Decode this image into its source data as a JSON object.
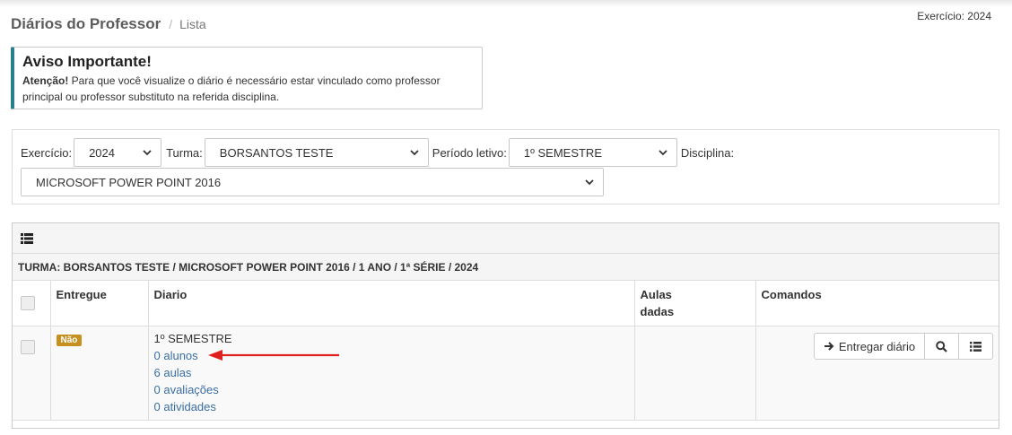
{
  "header": {
    "title": "Diários do Professor",
    "separator": "/",
    "crumb": "Lista",
    "exercicio": "Exercício: 2024"
  },
  "alert": {
    "title": "Aviso Importante!",
    "strong": "Atenção!",
    "line1": " Para que você visualize o diário é necessário estar vinculado como professor",
    "line2": "principal ou professor substituto na referida disciplina."
  },
  "filters": {
    "exercicio_label": "Exercício:",
    "exercicio_value": "2024",
    "turma_label": "Turma:",
    "turma_value": "BORSANTOS TESTE",
    "periodo_label": "Período letivo:",
    "periodo_value": "1º SEMESTRE",
    "disciplina_label": "Disciplina:",
    "disciplina_value": "MICROSOFT POWER POINT 2016"
  },
  "panel": {
    "turma_line": "TURMA: BORSANTOS TESTE / MICROSOFT POWER POINT 2016 / 1 ANO / 1ª SÉRIE / 2024",
    "columns": {
      "entregue": "Entregue",
      "diario": "Diario",
      "aulas_line1": "Aulas",
      "aulas_line2": "dadas",
      "comandos": "Comandos"
    },
    "row": {
      "badge": "Não",
      "periodo": "1º SEMESTRE",
      "alunos": "0 alunos",
      "aulas": "6 aulas",
      "avaliacoes": "0 avaliações",
      "atividades": "0 atividades",
      "entregar": "Entregar diário"
    }
  },
  "colors": {
    "alert_accent": "#2a7f8f",
    "badge": "#c59020",
    "link": "#3a6ea5",
    "annotation_arrow": "#e02020"
  }
}
